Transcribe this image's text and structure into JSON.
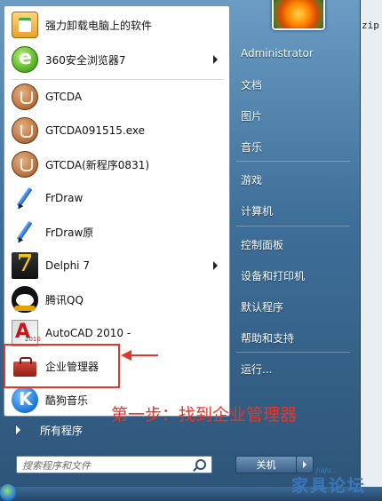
{
  "desktop": {
    "cut_text": "zip"
  },
  "left_panel": {
    "items": [
      {
        "label": "强力卸载电脑上的软件",
        "icon": "uninstall-icon",
        "submenu": false
      },
      {
        "label": "360安全浏览器7",
        "icon": "360-browser-icon",
        "submenu": true
      },
      {
        "label": "GTCDA",
        "icon": "gtcda-icon",
        "submenu": false
      },
      {
        "label": "GTCDA091515.exe",
        "icon": "gtcda-icon",
        "submenu": false
      },
      {
        "label": "GTCDA(新程序0831)",
        "icon": "gtcda-icon",
        "submenu": false
      },
      {
        "label": "FrDraw",
        "icon": "pen-icon",
        "submenu": false
      },
      {
        "label": "FrDraw原",
        "icon": "pen-icon",
        "submenu": false
      },
      {
        "label": "Delphi 7",
        "icon": "delphi-icon",
        "submenu": true
      },
      {
        "label": "腾讯QQ",
        "icon": "qq-penguin-icon",
        "submenu": false
      },
      {
        "label": "AutoCAD 2010 -",
        "icon": "autocad-icon",
        "submenu": false
      },
      {
        "label": "企业管理器",
        "icon": "toolbox-icon",
        "submenu": false
      },
      {
        "label": "酷狗音乐",
        "icon": "kugou-icon",
        "submenu": false
      }
    ],
    "all_programs": "所有程序"
  },
  "search": {
    "placeholder": "搜索程序和文件"
  },
  "right_panel": {
    "user": "Administrator",
    "items": [
      "文档",
      "图片",
      "音乐",
      "游戏",
      "计算机",
      "控制面板",
      "设备和打印机",
      "默认程序",
      "帮助和支持",
      "运行..."
    ]
  },
  "shutdown": {
    "label": "关机"
  },
  "annotation": {
    "text": "第一步：找到企业管理器",
    "color": "#e2372c"
  },
  "watermark": {
    "text": "家具论坛",
    "sub": "JiaJu..."
  },
  "colors": {
    "menu_blue": "#3e6f99",
    "panel_white": "#ffffff",
    "annotation_red": "#e2372c"
  }
}
